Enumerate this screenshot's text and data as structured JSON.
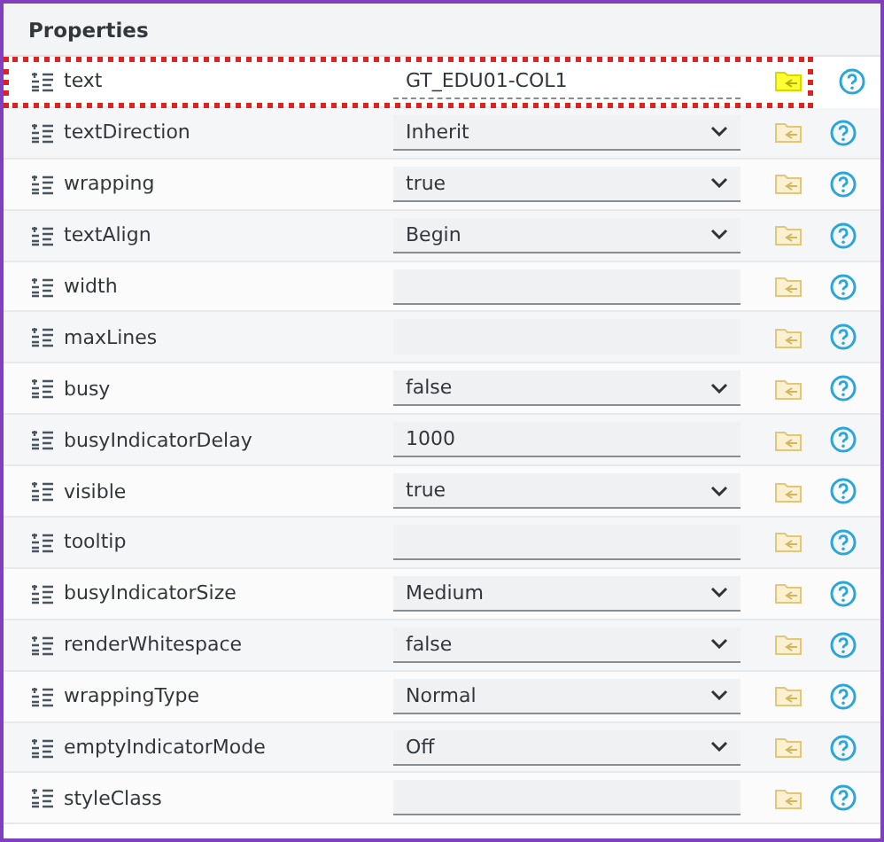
{
  "title": "Properties",
  "rows": [
    {
      "name": "text",
      "kind": "input",
      "value": "GT_EDU01-COL1",
      "bound": true,
      "highlighted": true
    },
    {
      "name": "textDirection",
      "kind": "select",
      "value": "Inherit",
      "bound": false,
      "highlighted": false
    },
    {
      "name": "wrapping",
      "kind": "select",
      "value": "true",
      "bound": false,
      "highlighted": false
    },
    {
      "name": "textAlign",
      "kind": "select",
      "value": "Begin",
      "bound": false,
      "highlighted": false
    },
    {
      "name": "width",
      "kind": "input",
      "bound": false,
      "highlighted": false
    },
    {
      "name": "maxLines",
      "kind": "readonly",
      "bound": false,
      "highlighted": false
    },
    {
      "name": "busy",
      "kind": "select",
      "value": "false",
      "bound": false,
      "highlighted": false
    },
    {
      "name": "busyIndicatorDelay",
      "kind": "input",
      "value": "1000",
      "bound": false,
      "highlighted": false
    },
    {
      "name": "visible",
      "kind": "select",
      "value": "true",
      "bound": false,
      "highlighted": false
    },
    {
      "name": "tooltip",
      "kind": "input",
      "bound": false,
      "highlighted": false
    },
    {
      "name": "busyIndicatorSize",
      "kind": "select",
      "value": "Medium",
      "bound": false,
      "highlighted": false
    },
    {
      "name": "renderWhitespace",
      "kind": "select",
      "value": "false",
      "bound": false,
      "highlighted": false
    },
    {
      "name": "wrappingType",
      "kind": "select",
      "value": "Normal",
      "bound": false,
      "highlighted": false
    },
    {
      "name": "emptyIndicatorMode",
      "kind": "select",
      "value": "Off",
      "bound": false,
      "highlighted": false
    },
    {
      "name": "styleClass",
      "kind": "input",
      "bound": false,
      "highlighted": false
    }
  ]
}
